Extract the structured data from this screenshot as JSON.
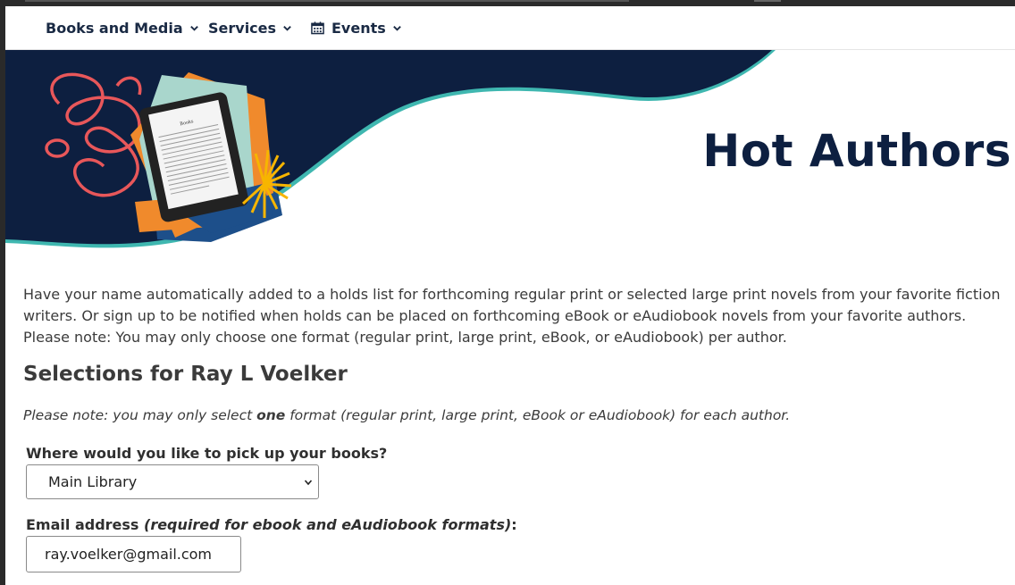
{
  "nav": {
    "items": [
      {
        "label": "Books and Media"
      },
      {
        "label": "Services"
      },
      {
        "label": "Events"
      }
    ]
  },
  "hero": {
    "title": "Hot Authors",
    "ereader_text": "Books"
  },
  "content": {
    "intro": "Have your name automatically added to a holds list for forthcoming regular print or selected large print novels from your favorite fiction writers. Or sign up to be notified when holds can be placed on forthcoming eBook or eAudiobook novels from your favorite authors. Please note: You may only choose one format (regular print, large print, eBook, or eAudiobook) per author.",
    "selections_title": "Selections for Ray L Voelker",
    "note_before": "Please note: you may only select ",
    "note_bold": "one",
    "note_after": " format (regular print, large print, eBook or eAudiobook) for each author.",
    "pickup_label": "Where would you like to pick up your books?",
    "pickup_selected": "Main Library",
    "email_label": "Email address ",
    "email_label_note": "(required for ebook and eAudiobook formats)",
    "email_label_colon": ":",
    "email_value": "ray.voelker@gmail.com"
  },
  "colors": {
    "navy": "#0d1f40",
    "teal_accent": "#3fb7b0",
    "coral": "#e8575a",
    "sunburst": "#f7b500"
  },
  "icons": {
    "chevron": "chevron-down-icon",
    "calendar": "calendar-icon"
  }
}
